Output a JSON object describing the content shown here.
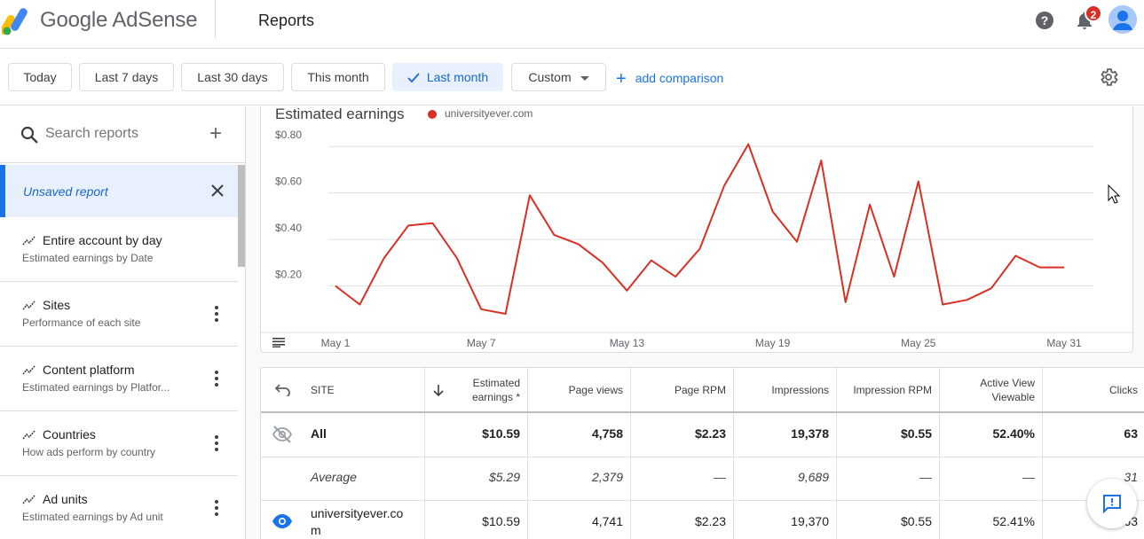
{
  "header": {
    "brand": "Google AdSense",
    "page_title": "Reports",
    "notification_count": "2"
  },
  "date_filters": {
    "chips": [
      {
        "label": "Today"
      },
      {
        "label": "Last 7 days"
      },
      {
        "label": "Last 30 days"
      },
      {
        "label": "This month"
      },
      {
        "label": "Last month",
        "selected": true
      },
      {
        "label": "Custom"
      }
    ],
    "add_comparison": "add comparison"
  },
  "sidebar": {
    "search_placeholder": "Search reports",
    "unsaved_report": "Unsaved report",
    "reports": [
      {
        "title": "Entire account by day",
        "subtitle": "Estimated earnings by Date"
      },
      {
        "title": "Sites",
        "subtitle": "Performance of each site"
      },
      {
        "title": "Content platform",
        "subtitle": "Estimated earnings by Platfor..."
      },
      {
        "title": "Countries",
        "subtitle": "How ads perform by country"
      },
      {
        "title": "Ad units",
        "subtitle": "Estimated earnings by Ad unit"
      }
    ]
  },
  "chart_data": {
    "type": "line",
    "title": "Estimated earnings",
    "series": [
      {
        "name": "universityever.com",
        "color": "#d93025",
        "values": [
          0.2,
          0.12,
          0.32,
          0.46,
          0.47,
          0.32,
          0.1,
          0.08,
          0.59,
          0.42,
          0.38,
          0.3,
          0.18,
          0.31,
          0.24,
          0.36,
          0.63,
          0.81,
          0.52,
          0.39,
          0.74,
          0.13,
          0.55,
          0.24,
          0.65,
          0.12,
          0.14,
          0.19,
          0.33,
          0.28,
          0.28
        ]
      }
    ],
    "x": [
      "May 1",
      "May 2",
      "May 3",
      "May 4",
      "May 5",
      "May 6",
      "May 7",
      "May 8",
      "May 9",
      "May 10",
      "May 11",
      "May 12",
      "May 13",
      "May 14",
      "May 15",
      "May 16",
      "May 17",
      "May 18",
      "May 19",
      "May 20",
      "May 21",
      "May 22",
      "May 23",
      "May 24",
      "May 25",
      "May 26",
      "May 27",
      "May 28",
      "May 29",
      "May 30",
      "May 31"
    ],
    "x_tick_labels": [
      "May 1",
      "May 7",
      "May 13",
      "May 19",
      "May 25",
      "May 31"
    ],
    "y_tick_labels": [
      "$0.20",
      "$0.40",
      "$0.60",
      "$0.80"
    ],
    "ylim": [
      0,
      0.9
    ],
    "grid": true
  },
  "table": {
    "columns": [
      "SITE",
      "Estimated earnings *",
      "Page views",
      "Page RPM",
      "Impressions",
      "Impression RPM",
      "Active View Viewable",
      "Clicks"
    ],
    "col_earnings_line1": "Estimated",
    "col_earnings_line2": "earnings *",
    "col_active_line1": "Active View",
    "col_active_line2": "Viewable",
    "rows": [
      {
        "site": "All",
        "earnings": "$10.59",
        "page_views": "4,758",
        "page_rpm": "$2.23",
        "impressions": "19,378",
        "impression_rpm": "$0.55",
        "active_view": "52.40%",
        "clicks": "63"
      },
      {
        "site": "Average",
        "earnings": "$5.29",
        "page_views": "2,379",
        "page_rpm": "—",
        "impressions": "9,689",
        "impression_rpm": "—",
        "active_view": "—",
        "clicks": "31"
      },
      {
        "site_line1": "universityever.co",
        "site_line2": "m",
        "earnings": "$10.59",
        "page_views": "4,741",
        "page_rpm": "$2.23",
        "impressions": "19,370",
        "impression_rpm": "$0.55",
        "active_view": "52.41%",
        "clicks": "63"
      }
    ]
  }
}
